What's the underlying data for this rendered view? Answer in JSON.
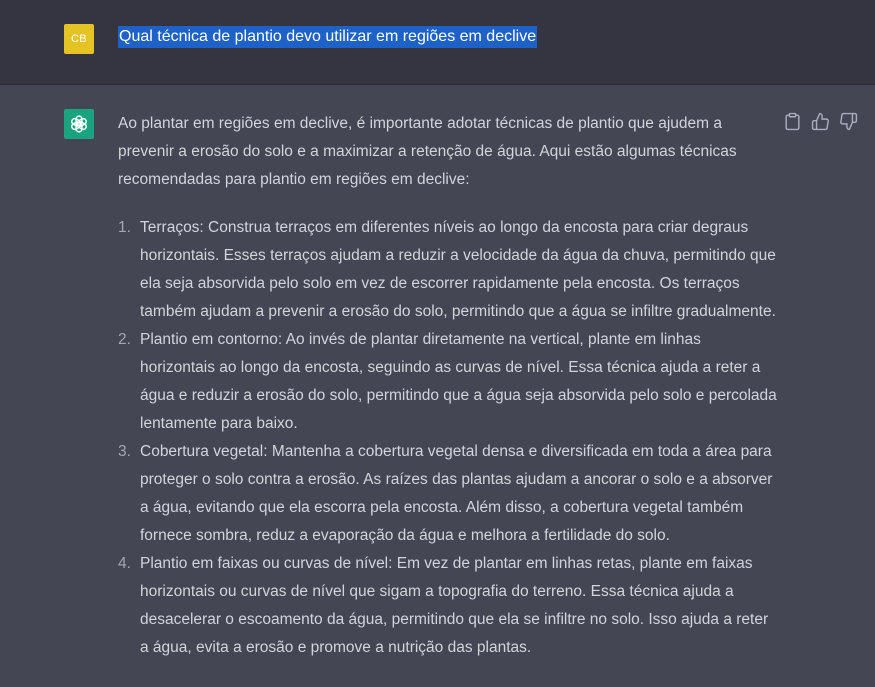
{
  "user": {
    "initials": "CB",
    "message": "Qual técnica de plantio devo utilizar em regiões em declive"
  },
  "assistant": {
    "intro": "Ao plantar em regiões em declive, é importante adotar técnicas de plantio que ajudem a prevenir a erosão do solo e a maximizar a retenção de água. Aqui estão algumas técnicas recomendadas para plantio em regiões em declive:",
    "items": [
      {
        "num": "1.",
        "text": "Terraços: Construa terraços em diferentes níveis ao longo da encosta para criar degraus horizontais. Esses terraços ajudam a reduzir a velocidade da água da chuva, permitindo que ela seja absorvida pelo solo em vez de escorrer rapidamente pela encosta. Os terraços também ajudam a prevenir a erosão do solo, permitindo que a água se infiltre gradualmente."
      },
      {
        "num": "2.",
        "text": "Plantio em contorno: Ao invés de plantar diretamente na vertical, plante em linhas horizontais ao longo da encosta, seguindo as curvas de nível. Essa técnica ajuda a reter a água e reduzir a erosão do solo, permitindo que a água seja absorvida pelo solo e percolada lentamente para baixo."
      },
      {
        "num": "3.",
        "text": "Cobertura vegetal: Mantenha a cobertura vegetal densa e diversificada em toda a área para proteger o solo contra a erosão. As raízes das plantas ajudam a ancorar o solo e a absorver a água, evitando que ela escorra pela encosta. Além disso, a cobertura vegetal também fornece sombra, reduz a evaporação da água e melhora a fertilidade do solo."
      },
      {
        "num": "4.",
        "text": "Plantio em faixas ou curvas de nível: Em vez de plantar em linhas retas, plante em faixas horizontais ou curvas de nível que sigam a topografia do terreno. Essa técnica ajuda a desacelerar o escoamento da água, permitindo que ela se infiltre no solo. Isso ajuda a reter a água, evita a erosão e promove a nutrição das plantas."
      }
    ]
  },
  "icons": {
    "assistant_avatar": "openai-logo-icon",
    "copy": "clipboard-icon",
    "like": "thumbs-up-icon",
    "dislike": "thumbs-down-icon"
  },
  "colors": {
    "user_bg": "#343541",
    "assistant_bg": "#444654",
    "user_avatar": "#e4c325",
    "assistant_avatar": "#19a37f",
    "selection": "#1f62c7"
  }
}
